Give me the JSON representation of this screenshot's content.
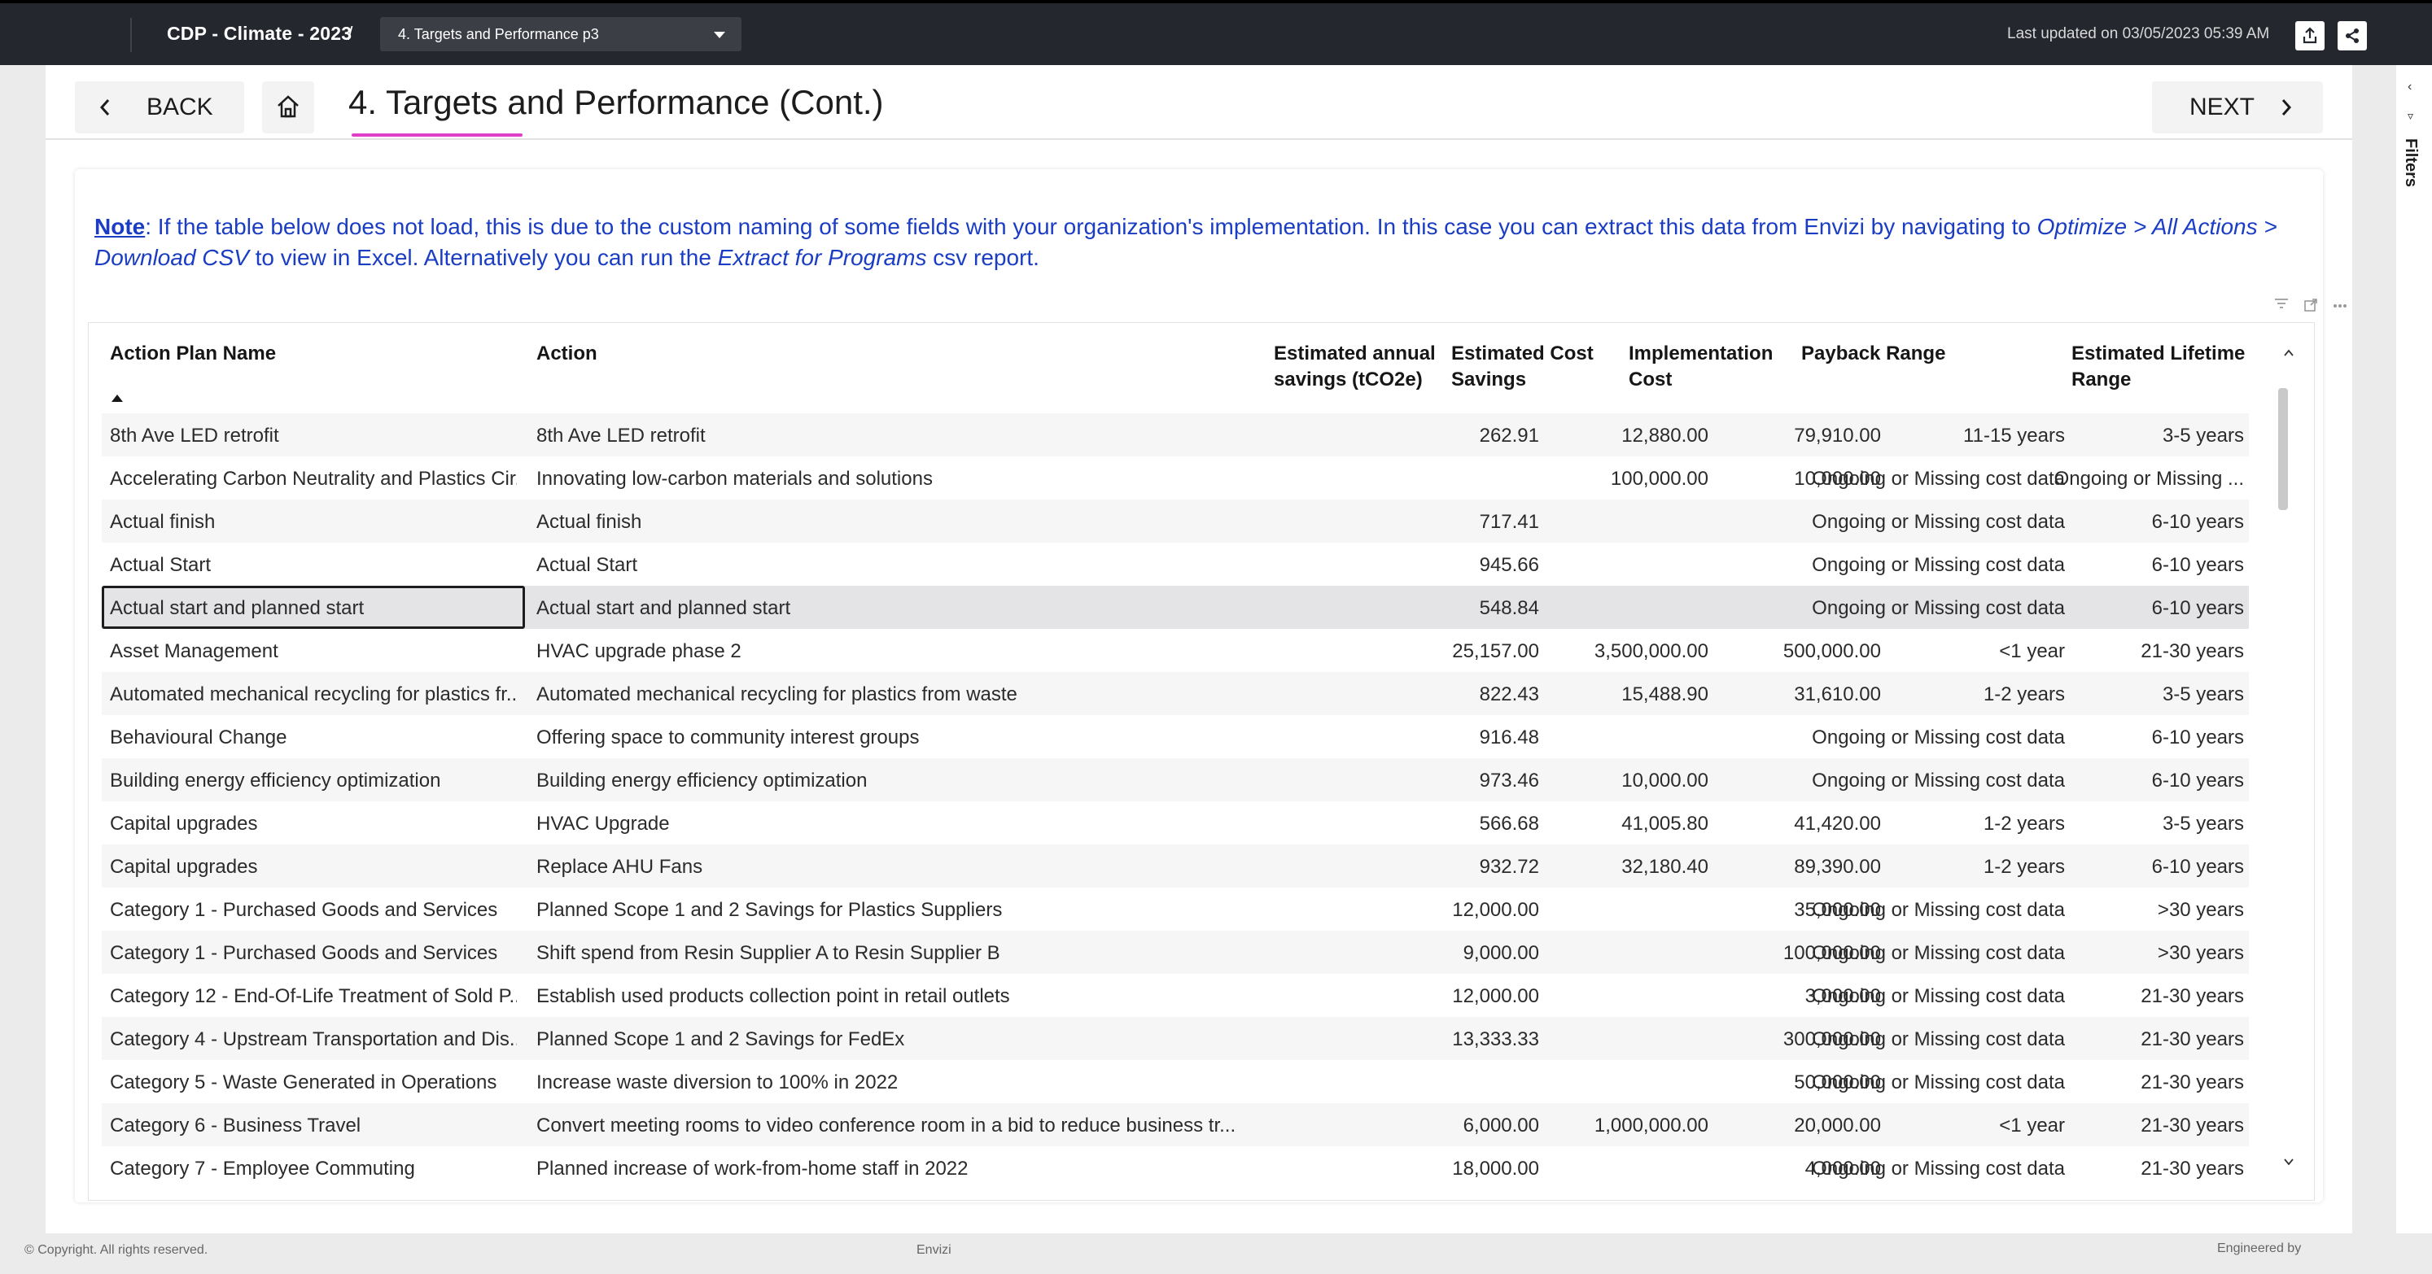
{
  "topbar": {
    "app_title": "CDP - Climate - 2023",
    "separator": "/",
    "page_select_value": "4. Targets and Performance p3",
    "last_updated": "Last updated on 03/05/2023 05:39 AM",
    "icons": [
      "export-icon",
      "share-icon"
    ]
  },
  "nav": {
    "back_label": "BACK",
    "page_title": "4. Targets and Performance (Cont.)",
    "next_label": "NEXT"
  },
  "note": {
    "label": "Note",
    "text_1": ": If the table below does not load, this is due to the custom naming of some fields with your organization's implementation. In this case you can extract this data from Envizi by navigating to ",
    "path": "Optimize > All Actions > Download CSV",
    "text_2": " to view in Excel. Alternatively you can run the ",
    "report": "Extract for Programs",
    "text_3": " csv report."
  },
  "table": {
    "columns": [
      "Action Plan Name",
      "Action",
      "Estimated annual savings (tCO2e)",
      "Estimated Cost Savings",
      "Implementation Cost",
      "Payback Range",
      "Estimated Lifetime Range"
    ],
    "rows": [
      [
        "8th Ave LED retrofit",
        "8th Ave LED retrofit",
        "262.91",
        "12,880.00",
        "79,910.00",
        "11-15 years",
        "3-5 years"
      ],
      [
        "Accelerating Carbon Neutrality and Plastics Cir...",
        "Innovating low-carbon materials and solutions",
        "",
        "100,000.00",
        "10,000.00",
        "Ongoing or Missing cost data",
        "Ongoing or Missing ..."
      ],
      [
        "Actual finish",
        "Actual finish",
        "717.41",
        "",
        "",
        "Ongoing or Missing cost data",
        "6-10 years"
      ],
      [
        "Actual Start",
        "Actual Start",
        "945.66",
        "",
        "",
        "Ongoing or Missing cost data",
        "6-10 years"
      ],
      [
        "Actual start and planned start",
        "Actual start and planned start",
        "548.84",
        "",
        "",
        "Ongoing or Missing cost data",
        "6-10 years"
      ],
      [
        "Asset Management",
        "HVAC upgrade phase 2",
        "25,157.00",
        "3,500,000.00",
        "500,000.00",
        "<1 year",
        "21-30 years"
      ],
      [
        "Automated mechanical recycling for plastics fr...",
        "Automated mechanical recycling for plastics from waste",
        "822.43",
        "15,488.90",
        "31,610.00",
        "1-2 years",
        "3-5 years"
      ],
      [
        "Behavioural Change",
        "Offering space to community interest groups",
        "916.48",
        "",
        "",
        "Ongoing or Missing cost data",
        "6-10 years"
      ],
      [
        "Building energy efficiency optimization",
        "Building energy efficiency optimization",
        "973.46",
        "10,000.00",
        "",
        "Ongoing or Missing cost data",
        "6-10 years"
      ],
      [
        "Capital upgrades",
        "HVAC Upgrade",
        "566.68",
        "41,005.80",
        "41,420.00",
        "1-2 years",
        "3-5 years"
      ],
      [
        "Capital upgrades",
        "Replace AHU Fans",
        "932.72",
        "32,180.40",
        "89,390.00",
        "1-2 years",
        "6-10 years"
      ],
      [
        "Category 1 - Purchased Goods and Services",
        "Planned Scope 1 and 2 Savings for Plastics Suppliers",
        "12,000.00",
        "",
        "35,000.00",
        "Ongoing or Missing cost data",
        ">30 years"
      ],
      [
        "Category 1 - Purchased Goods and Services",
        "Shift spend from Resin Supplier A to Resin Supplier B",
        "9,000.00",
        "",
        "100,000.00",
        "Ongoing or Missing cost data",
        ">30 years"
      ],
      [
        "Category 12 - End-Of-Life Treatment of Sold P...",
        "Establish used products collection point in retail outlets",
        "12,000.00",
        "",
        "3,000.00",
        "Ongoing or Missing cost data",
        "21-30 years"
      ],
      [
        "Category 4 - Upstream Transportation and Dis...",
        "Planned Scope 1 and 2 Savings for FedEx",
        "13,333.33",
        "",
        "300,000.00",
        "Ongoing or Missing cost data",
        "21-30 years"
      ],
      [
        "Category 5 - Waste Generated in Operations",
        "Increase waste diversion to 100% in 2022",
        "",
        "",
        "50,000.00",
        "Ongoing or Missing cost data",
        "21-30 years"
      ],
      [
        "Category 6 - Business Travel",
        "Convert meeting rooms to video conference room in a bid to reduce business tr...",
        "6,000.00",
        "1,000,000.00",
        "20,000.00",
        "<1 year",
        "21-30 years"
      ],
      [
        "Category 7 - Employee Commuting",
        "Planned increase of work-from-home staff in 2022",
        "18,000.00",
        "",
        "4,000.00",
        "Ongoing or Missing cost data",
        "21-30 years"
      ]
    ],
    "selected_row": 4
  },
  "rail": {
    "label": "Filters"
  },
  "footer": {
    "copyright": "© Copyright. All rights reserved.",
    "brand": "Envizi",
    "engineered": "Engineered by"
  },
  "colors": {
    "topbar": "#24272d",
    "note_text": "#1a3dc4",
    "title_accent": "#e040c8"
  }
}
